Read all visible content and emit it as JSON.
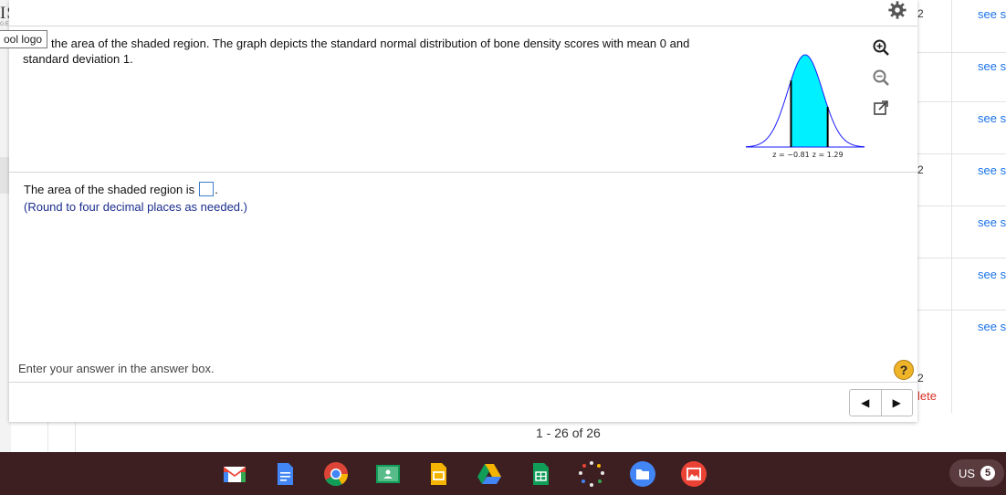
{
  "background": {
    "logo_letters": "IS",
    "logo_sub": "GE",
    "right_rows": [
      {
        "num": "2",
        "link": "see s"
      },
      {
        "num": "",
        "link": "see s"
      },
      {
        "num": "",
        "link": "see s"
      },
      {
        "num": "2",
        "link": "see s"
      },
      {
        "num": "",
        "link": "see s"
      },
      {
        "num": "",
        "link": "see s"
      },
      {
        "num": "",
        "link": "see s"
      }
    ],
    "row_num_bottom": "2",
    "delete_fragment": "lete",
    "pagination": "1 - 26 of 26"
  },
  "modal": {
    "logo_alt": "ool logo",
    "question": "the area of the shaded region. The graph depicts the standard normal distribution of bone density scores with mean 0 and standard deviation 1.",
    "graph": {
      "z_left_label": "z = −0.81",
      "z_right_label": "z = 1.29",
      "z_left": -0.81,
      "z_right": 1.29,
      "fill_color": "#00f0ff",
      "curve_color": "#1a1aff"
    },
    "answer_prefix": "The area of the shaded region is",
    "answer_suffix": ".",
    "answer_value": "",
    "hint": "(Round to four decimal places as needed.)",
    "instruction": "Enter your answer in the answer box.",
    "help_label": "?",
    "prev_label": "◀",
    "next_label": "▶"
  },
  "shelf": {
    "locale": "US",
    "notification_count": "5",
    "apps": [
      "gmail-icon",
      "docs-icon",
      "chrome-icon",
      "classroom-icon",
      "slides-icon",
      "drive-icon",
      "sheets-icon",
      "launcher-dots-icon",
      "files-icon",
      "gallery-icon"
    ]
  }
}
